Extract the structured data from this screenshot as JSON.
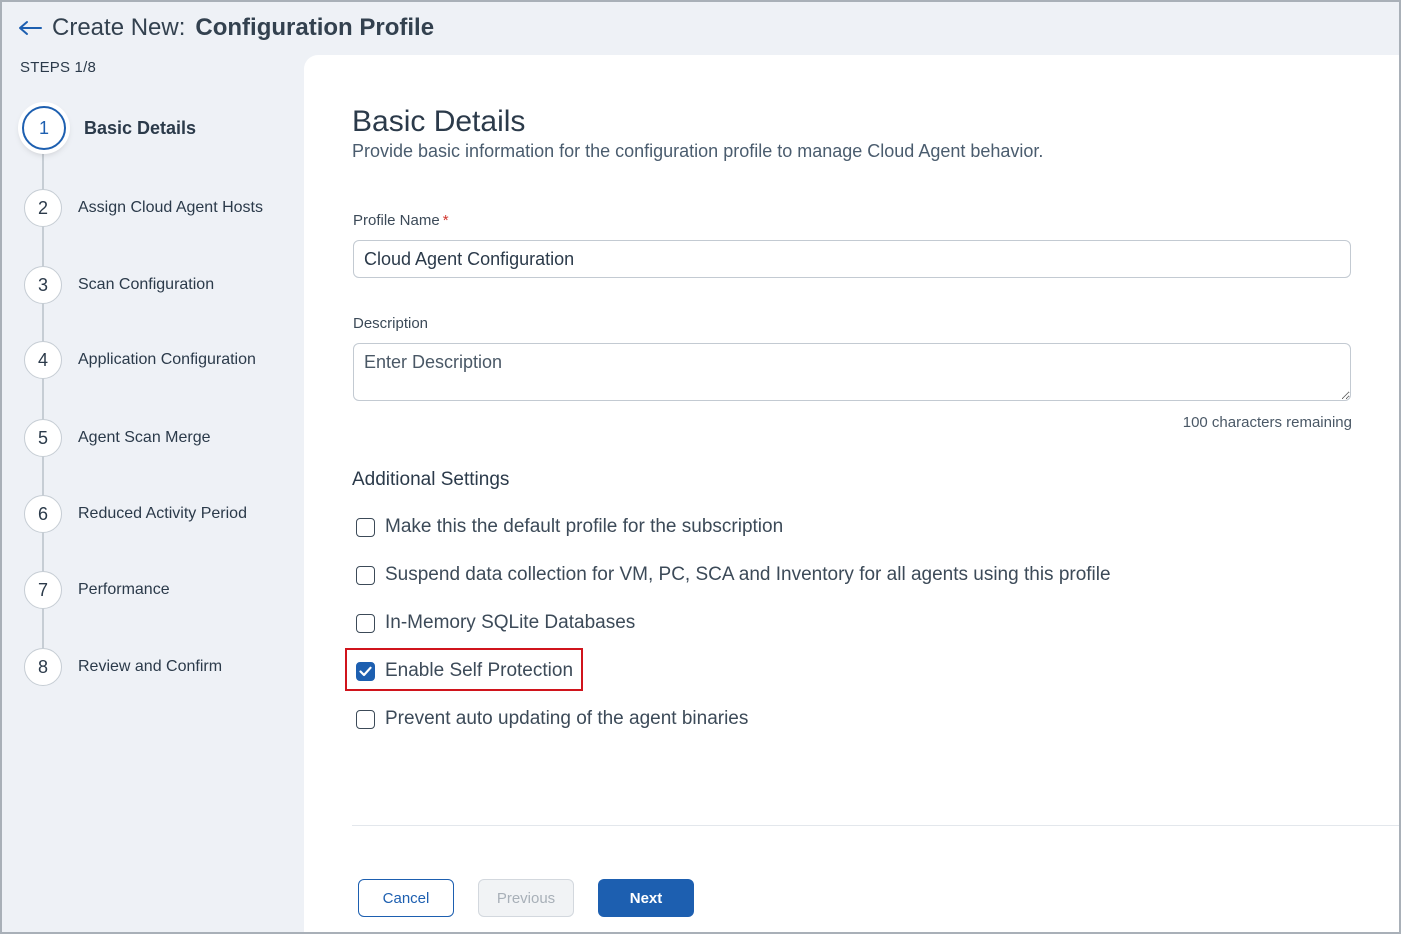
{
  "header": {
    "prefix": "Create New:",
    "title": "Configuration Profile"
  },
  "sidebar": {
    "steps_label": "STEPS 1/8",
    "steps": [
      {
        "number": "1",
        "label": "Basic Details",
        "active": true
      },
      {
        "number": "2",
        "label": "Assign Cloud Agent Hosts"
      },
      {
        "number": "3",
        "label": "Scan Configuration"
      },
      {
        "number": "4",
        "label": "Application Configuration"
      },
      {
        "number": "5",
        "label": "Agent Scan Merge"
      },
      {
        "number": "6",
        "label": "Reduced Activity Period"
      },
      {
        "number": "7",
        "label": "Performance"
      },
      {
        "number": "8",
        "label": "Review and Confirm"
      }
    ]
  },
  "main": {
    "title": "Basic Details",
    "subtitle": "Provide basic information for the configuration profile to manage Cloud Agent behavior.",
    "profile_name": {
      "label": "Profile Name",
      "required_mark": "*",
      "value": "Cloud Agent Configuration"
    },
    "description": {
      "label": "Description",
      "placeholder": "Enter Description",
      "char_count": "100 characters remaining"
    },
    "additional_settings": {
      "heading": "Additional Settings",
      "options": [
        {
          "label": "Make this the default profile for the subscription",
          "checked": false
        },
        {
          "label": "Suspend data collection for VM, PC, SCA and Inventory for all agents using this profile",
          "checked": false
        },
        {
          "label": "In-Memory SQLite Databases",
          "checked": false
        },
        {
          "label": "Enable Self Protection",
          "checked": true
        },
        {
          "label": "Prevent auto updating of the agent binaries",
          "checked": false
        }
      ]
    }
  },
  "footer": {
    "cancel_label": "Cancel",
    "previous_label": "Previous",
    "next_label": "Next"
  },
  "colors": {
    "accent": "#1d5fb0",
    "highlight": "#d0141c",
    "sidebar_bg": "#eef1f6"
  }
}
